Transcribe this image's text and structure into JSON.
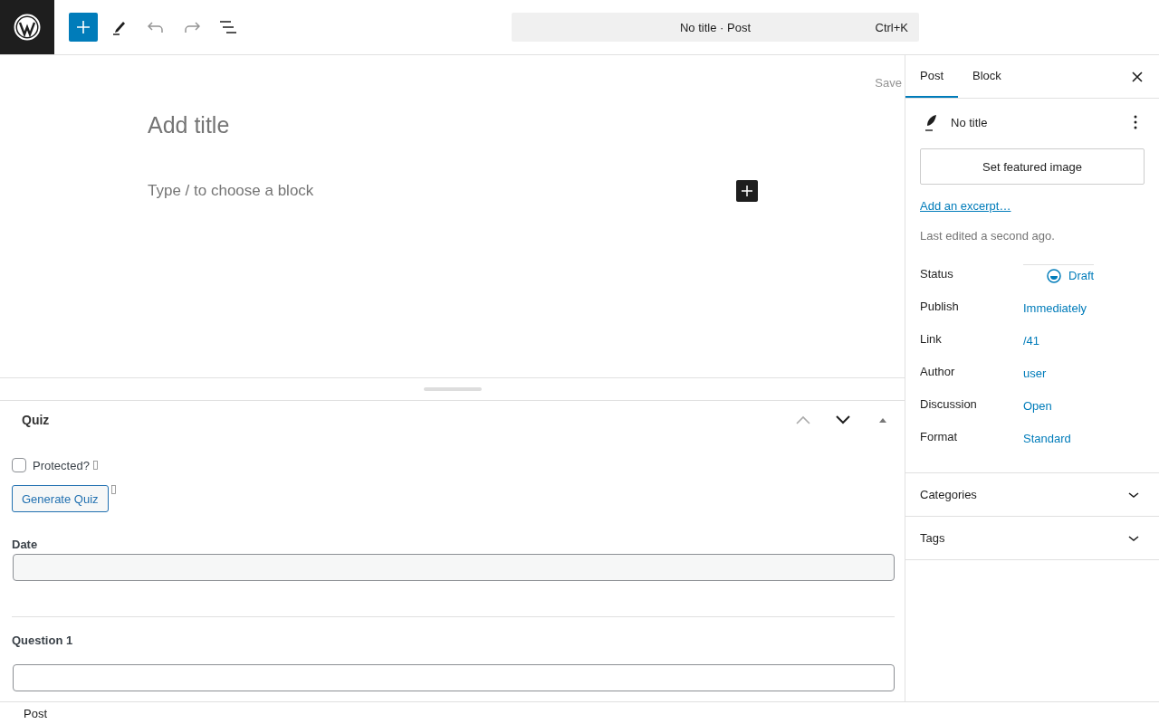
{
  "toolbar": {
    "tools": [
      {
        "kind": "add",
        "disabled": false
      },
      {
        "kind": "edit",
        "disabled": false
      },
      {
        "kind": "undo",
        "disabled": true
      },
      {
        "kind": "redo",
        "disabled": true
      },
      {
        "kind": "outline",
        "disabled": false
      }
    ],
    "document_title": "No title · Post",
    "shortcut": "Ctrl+K"
  },
  "editor": {
    "save_label": "Save",
    "title_placeholder": "Add title",
    "block_placeholder": "Type / to choose a block"
  },
  "meta_box": {
    "title": "Quiz",
    "move_up_disabled": true,
    "protected": {
      "label": "Protected?",
      "checked": false
    },
    "generate_button": "Generate Quiz",
    "date_label": "Date",
    "question_label": "Question 1"
  },
  "sidebar": {
    "tabs": [
      {
        "label": "Post",
        "selected": true
      },
      {
        "label": "Block",
        "selected": false
      }
    ],
    "post_title": "No title",
    "featured_button": "Set featured image",
    "excerpt_link": "Add an excerpt…",
    "last_edited": "Last edited a second ago.",
    "rows": [
      {
        "label": "Status",
        "value": "Draft",
        "kind": "status"
      },
      {
        "label": "Publish",
        "value": "Immediately",
        "kind": "link"
      },
      {
        "label": "Link",
        "value": "/41",
        "kind": "link"
      },
      {
        "label": "Author",
        "value": "user",
        "kind": "link"
      },
      {
        "label": "Discussion",
        "value": "Open",
        "kind": "link"
      },
      {
        "label": "Format",
        "value": "Standard",
        "kind": "link"
      }
    ],
    "panels": [
      {
        "title": "Categories",
        "expanded": false
      },
      {
        "title": "Tags",
        "expanded": false
      }
    ]
  },
  "status_bar": {
    "breadcrumb": "Post"
  }
}
